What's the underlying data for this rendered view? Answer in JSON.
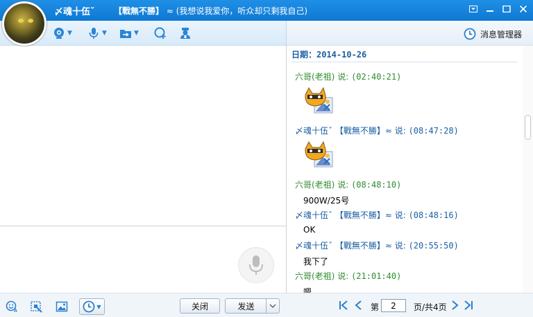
{
  "title": {
    "nickname": "〆魂十伍ˇ",
    "group_tag": "【戰無不勝】",
    "signature": "≈ (我想说我爱你，听众却只剩我自己)"
  },
  "header": {
    "message_manager": "消息管理器"
  },
  "history": {
    "date_label": "日期：2014-10-26",
    "messages": [
      {
        "sender": "六哥(老祖)",
        "says": "说:",
        "time": "(02:40:21)",
        "body": "",
        "type": "emoji"
      },
      {
        "sender": "〆魂十伍ˇ 【戰無不勝】≈",
        "says": "说:",
        "time": "(08:47:28)",
        "body": "",
        "type": "emoji"
      },
      {
        "sender": "六哥(老祖)",
        "says": "说:",
        "time": "(08:48:10)",
        "body": "900W/25号",
        "type": "text"
      },
      {
        "sender": "〆魂十伍ˇ 【戰無不勝】≈",
        "says": "说:",
        "time": "(08:48:16)",
        "body": "OK",
        "type": "text"
      },
      {
        "sender": "〆魂十伍ˇ 【戰無不勝】≈",
        "says": "说:",
        "time": "(20:55:50)",
        "body": "我下了",
        "type": "text"
      },
      {
        "sender": "六哥(老祖)",
        "says": "说:",
        "time": "(21:01:40)",
        "body": "嗯",
        "type": "text"
      }
    ]
  },
  "bottom": {
    "close_label": "关闭",
    "send_label": "发送"
  },
  "pager": {
    "page_prefix": "第",
    "current_page": "2",
    "page_suffix": "页/共4页"
  },
  "colors": {
    "title_bar": "#1784dd",
    "accent": "#2a86d4",
    "sender_green": "#2e8b2e",
    "sender_blue": "#1a5fa6"
  }
}
